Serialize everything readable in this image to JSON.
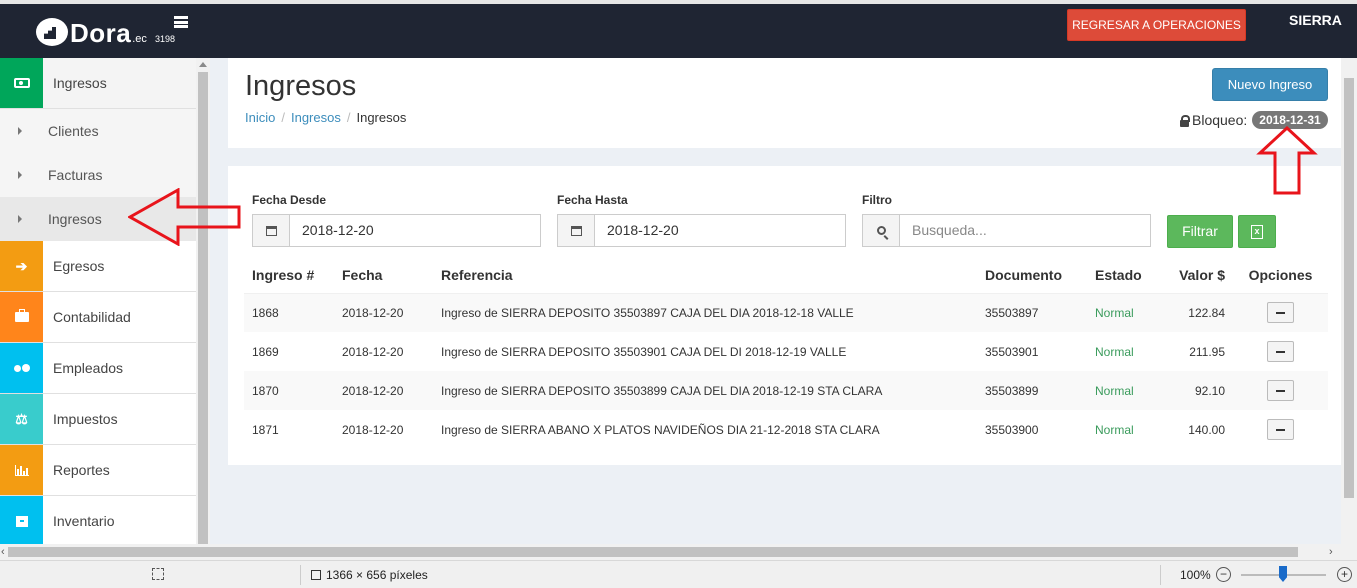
{
  "topbar": {
    "logo_text": "Dora",
    "logo_tld": ".ec",
    "logo_number": "3198",
    "regresar_label": "REGRESAR A OPERACIONES",
    "user_name": "SIERRA"
  },
  "sidebar": {
    "items": [
      {
        "label": "Ingresos",
        "icon": "money-icon",
        "color": "#00a65a"
      },
      {
        "label": "Clientes"
      },
      {
        "label": "Facturas"
      },
      {
        "label": "Ingresos"
      },
      {
        "label": "Egresos",
        "icon": "sign-in-icon",
        "color": "#f39c12"
      },
      {
        "label": "Contabilidad",
        "icon": "briefcase-icon",
        "color": "#ff851b"
      },
      {
        "label": "Empleados",
        "icon": "users-icon",
        "color": "#00c0ef"
      },
      {
        "label": "Impuestos",
        "icon": "balance-scale-icon",
        "color": "#39cccc"
      },
      {
        "label": "Reportes",
        "icon": "bar-chart-icon",
        "color": "#f39c12"
      },
      {
        "label": "Inventario",
        "icon": "archive-icon",
        "color": "#00c0ef"
      }
    ]
  },
  "header": {
    "title": "Ingresos",
    "breadcrumb": [
      "Inicio",
      "Ingresos",
      "Ingresos"
    ],
    "nuevo_label": "Nuevo Ingreso",
    "bloqueo_label": "Bloqueo:",
    "bloqueo_date": "2018-12-31"
  },
  "filters": {
    "desde_label": "Fecha Desde",
    "desde_value": "2018-12-20",
    "hasta_label": "Fecha Hasta",
    "hasta_value": "2018-12-20",
    "filtro_label": "Filtro",
    "filtro_placeholder": "Busqueda...",
    "filtrar_label": "Filtrar"
  },
  "table": {
    "columns": [
      "Ingreso #",
      "Fecha",
      "Referencia",
      "Documento",
      "Estado",
      "Valor $",
      "Opciones"
    ],
    "rows": [
      {
        "id": "1868",
        "fecha": "2018-12-20",
        "ref": "Ingreso de SIERRA DEPOSITO 35503897 CAJA DEL DIA 2018-12-18 VALLE",
        "doc": "35503897",
        "estado": "Normal",
        "valor": "122.84"
      },
      {
        "id": "1869",
        "fecha": "2018-12-20",
        "ref": "Ingreso de SIERRA DEPOSITO 35503901 CAJA DEL DI 2018-12-19 VALLE",
        "doc": "35503901",
        "estado": "Normal",
        "valor": "211.95"
      },
      {
        "id": "1870",
        "fecha": "2018-12-20",
        "ref": "Ingreso de SIERRA DEPOSITO 35503899 CAJA DEL DIA 2018-12-19 STA CLARA",
        "doc": "35503899",
        "estado": "Normal",
        "valor": "92.10"
      },
      {
        "id": "1871",
        "fecha": "2018-12-20",
        "ref": "Ingreso de SIERRA ABANO X PLATOS NAVIDEÑOS DIA 21-12-2018 STA CLARA",
        "doc": "35503900",
        "estado": "Normal",
        "valor": "140.00"
      }
    ]
  },
  "statusbar": {
    "dimensions": "1366 × 656 píxeles",
    "zoom": "100%"
  },
  "colors": {
    "topbar": "#1f2533",
    "accent_blue": "#3c8dbc",
    "danger": "#dd4b39",
    "success": "#5cb85c",
    "annotation_red": "#e8141b"
  }
}
